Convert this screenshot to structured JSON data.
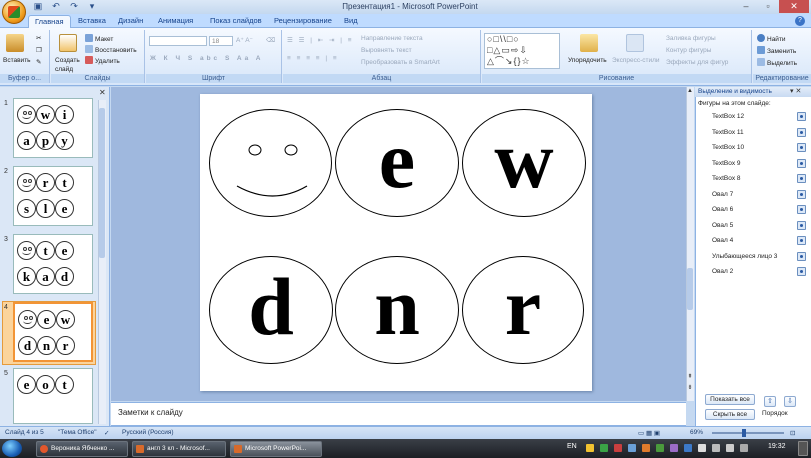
{
  "window": {
    "title": "Презентация1 - Microsoft PowerPoint"
  },
  "tabs": [
    "Главная",
    "Вставка",
    "Дизайн",
    "Анимация",
    "Показ слайдов",
    "Рецензирование",
    "Вид"
  ],
  "ribbon": {
    "clipboard": {
      "label": "Буфер о...",
      "paste": "Вставить"
    },
    "slides": {
      "label": "Слайды",
      "new_slide": "Создать слайд",
      "layout": "Макет",
      "reset": "Восстановить",
      "delete": "Удалить"
    },
    "font": {
      "label": "Шрифт",
      "size": "18"
    },
    "paragraph": {
      "label": "Абзац",
      "text_direction": "Направление текста",
      "align_text": "Выровнять текст",
      "smartart": "Преобразовать в SmartArt"
    },
    "drawing": {
      "label": "Рисование",
      "arrange": "Упорядочить",
      "quick_styles": "Экспресс-стили",
      "fill": "Заливка фигуры",
      "outline": "Контур фигуры",
      "effects": "Эффекты для фигур"
    },
    "editing": {
      "label": "Редактирование",
      "find": "Найти",
      "replace": "Заменить",
      "select": "Выделить"
    }
  },
  "thumbnails": [
    {
      "num": "1",
      "letters": [
        "w",
        "i",
        "a",
        "p",
        "y"
      ]
    },
    {
      "num": "2",
      "letters": [
        "r",
        "t",
        "s",
        "l",
        "e"
      ]
    },
    {
      "num": "3",
      "letters": [
        "t",
        "e",
        "k",
        "a",
        "d"
      ]
    },
    {
      "num": "4",
      "letters": [
        "e",
        "w",
        "d",
        "n",
        "r"
      ]
    },
    {
      "num": "5",
      "letters": [
        "e",
        "o",
        "t"
      ]
    }
  ],
  "slide": {
    "letters": [
      "e",
      "w",
      "d",
      "n",
      "r"
    ]
  },
  "notes": {
    "placeholder": "Заметки к слайду"
  },
  "selection_pane": {
    "title": "Выделение и видимость",
    "subtitle": "Фигуры на этом слайде:",
    "items": [
      "TextBox 12",
      "TextBox 11",
      "TextBox 10",
      "TextBox 9",
      "TextBox 8",
      "Овал 7",
      "Овал 6",
      "Овал 5",
      "Овал 4",
      "Улыбающееся лицо 3",
      "Овал 2"
    ],
    "show_all": "Показать все",
    "hide_all": "Скрыть все",
    "order": "Порядок"
  },
  "status": {
    "slide_info": "Слайд 4 из 5",
    "theme": "\"Тема Office\"",
    "language": "Русский (Россия)",
    "zoom": "69%"
  },
  "taskbar": {
    "items": [
      "Вероника Ябченко ...",
      "англ 3 кл - Microsof...",
      "Microsoft PowerPoi..."
    ],
    "lang": "EN",
    "time": "19:32"
  },
  "colors": {
    "accent": "#f29436",
    "ribbon": "#bfdbff",
    "taskbar": "#2a2e35"
  }
}
